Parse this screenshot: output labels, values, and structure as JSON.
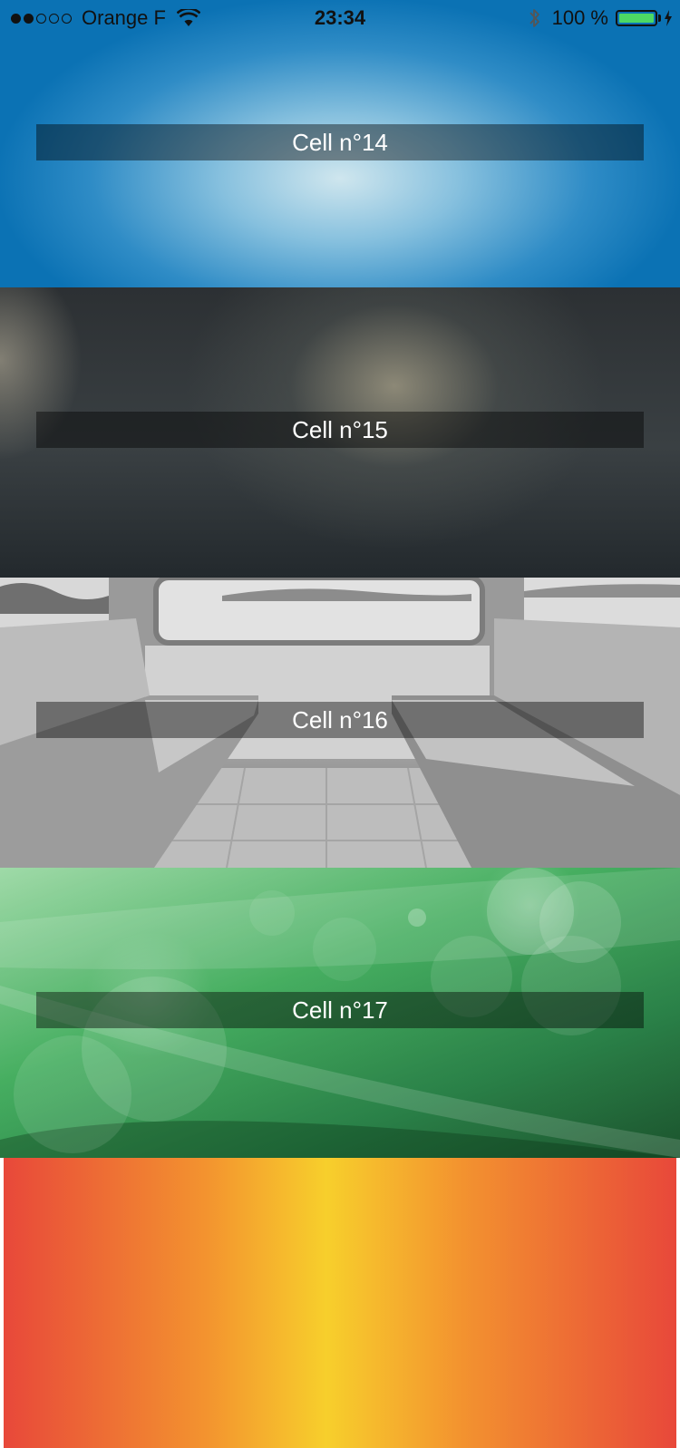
{
  "status_bar": {
    "carrier": "Orange F",
    "time": "23:34",
    "battery_label": "100 %",
    "battery_level": 1.0,
    "signal_bars_filled": 2,
    "signal_bars_total": 5,
    "icons": [
      "signal-icon",
      "wifi-icon",
      "bluetooth-icon",
      "battery-icon",
      "charging-icon"
    ]
  },
  "cells": [
    {
      "label": "Cell n°14",
      "background": "blue-radial"
    },
    {
      "label": "Cell n°15",
      "background": "dark-bokeh"
    },
    {
      "label": "Cell n°16",
      "background": "grayscale-train-interior"
    },
    {
      "label": "Cell n°17",
      "background": "green-bokeh"
    },
    {
      "label": "",
      "background": "orange-yellow-gradient"
    }
  ],
  "colors": {
    "label_bar": "#000000",
    "label_text": "#ffffff",
    "battery_fill": "#4cd964"
  }
}
